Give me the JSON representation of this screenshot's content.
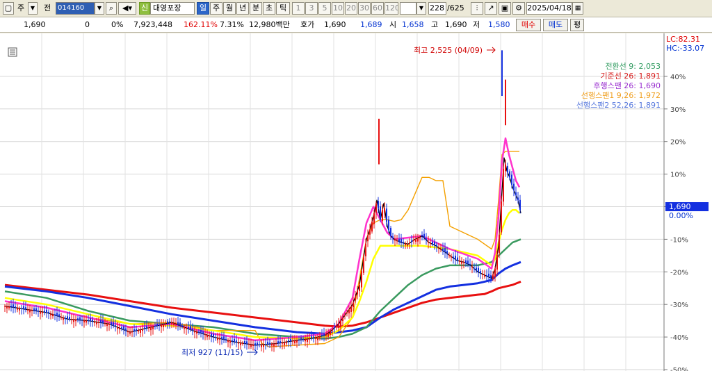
{
  "toolbar": {
    "tab_stock": "주",
    "tab_all": "전",
    "code": "014160",
    "credit_badge": "신",
    "stock_name": "대영포장",
    "periods": [
      "일",
      "주",
      "월",
      "년",
      "분",
      "초",
      "틱"
    ],
    "intervals": [
      "1",
      "3",
      "5",
      "10",
      "20",
      "30",
      "60",
      "120"
    ],
    "count": "228",
    "count_total": "/625",
    "date": "2025/04/18"
  },
  "quote": {
    "price": "1,690",
    "change": "0",
    "change_rate": "0%",
    "volume": "7,923,448",
    "volume_rate": "162.11%",
    "turnover": "7.31%",
    "amount": "12,980백만",
    "ask_label": "호가",
    "ask": "1,690",
    "bid": "1,689",
    "open_label": "시",
    "open": "1,658",
    "high_label": "고",
    "high": "1,690",
    "low_label": "저",
    "low": "1,580",
    "buy_label": "매수",
    "sell_label": "매도",
    "eval_label": "평"
  },
  "chart_data": {
    "type": "line",
    "y_unit": "%",
    "ylim": [
      -50,
      50
    ],
    "yticks": [
      "40%",
      "30%",
      "20%",
      "10%",
      "0.00%",
      "-10%",
      "-20%",
      "-30%",
      "-40%",
      "-50%"
    ],
    "lc_label": "LC:82.31",
    "hc_label": "HC:-33.07",
    "current_price_label": "1,690",
    "current_pct_label": "0.00%",
    "annotation_high": "최고 2,525 (04/09)",
    "annotation_low": "최저 927 (11/15)",
    "grid": true,
    "legend_placement": "top-right",
    "legend": [
      {
        "label": "전환선 9: 2,053",
        "color": "#2e9a5e"
      },
      {
        "label": "기준선 26: 1,891",
        "color": "#d81b1b"
      },
      {
        "label": "후행스팬 26: 1,690",
        "color": "#9a2fd0"
      },
      {
        "label": "선행스팬1 9,26: 1,972",
        "color": "#f0a020"
      },
      {
        "label": "선행스팬2 52,26: 1,891",
        "color": "#5577dd"
      }
    ],
    "colors": {
      "price": "#000000",
      "ma_pink": "#ff33cc",
      "ma_yellow": "#ffff00",
      "ma_orange": "#f4a000",
      "ma_green": "#3a9a5f",
      "ma_blue": "#1430e0",
      "ma_red": "#e81010",
      "up": "#e81010",
      "down": "#1430e0"
    },
    "series": [
      {
        "key": "close",
        "x": [
          0,
          30,
          60,
          90,
          120,
          150,
          180,
          210,
          240,
          270,
          300,
          330,
          360,
          390,
          420,
          440,
          460,
          470,
          480,
          490,
          500,
          510,
          515,
          520,
          525,
          530,
          535,
          540,
          545,
          550,
          555,
          560,
          570,
          580,
          590,
          600,
          610,
          620,
          630,
          640,
          650,
          660,
          670,
          680,
          690,
          700,
          705,
          710,
          715,
          718,
          722,
          726,
          730,
          734,
          738,
          742
        ],
        "y": [
          -30.5,
          -31.5,
          -32.5,
          -34.5,
          -35,
          -36,
          -38.5,
          -37,
          -35.5,
          -38,
          -40,
          -41.5,
          -42.5,
          -42,
          -41,
          -40.5,
          -39.5,
          -38,
          -36,
          -33,
          -30,
          -24,
          -17,
          -10,
          -7,
          -3,
          2,
          -4,
          1,
          -6,
          -9,
          -10,
          -11,
          -11.5,
          -10,
          -9,
          -11,
          -12,
          -13.5,
          -15,
          -16.5,
          -17,
          -18,
          -20,
          -21,
          -22,
          -19,
          -12,
          5,
          15,
          11,
          9,
          6,
          4,
          2,
          -2
        ]
      },
      {
        "key": "ma_pink",
        "x": [
          0,
          60,
          120,
          180,
          240,
          300,
          360,
          420,
          460,
          480,
          500,
          510,
          520,
          530,
          540,
          550,
          560,
          600,
          640,
          680,
          700,
          705,
          710,
          715,
          720,
          725,
          730,
          735,
          740
        ],
        "y": [
          -29,
          -31,
          -34,
          -37,
          -36,
          -39,
          -41,
          -40,
          -39,
          -36,
          -28,
          -16,
          -5,
          0,
          -4,
          -8,
          -10,
          -9,
          -13,
          -16,
          -19,
          -14,
          -3,
          14,
          21,
          16,
          12,
          8,
          6
        ]
      },
      {
        "key": "ma_yellow",
        "x": [
          0,
          60,
          120,
          180,
          240,
          300,
          360,
          420,
          460,
          480,
          500,
          510,
          520,
          530,
          540,
          550,
          560,
          600,
          640,
          680,
          700,
          705,
          710,
          715,
          720,
          725,
          730,
          735,
          740
        ],
        "y": [
          -28,
          -30,
          -33,
          -36,
          -36.5,
          -38,
          -40,
          -40.5,
          -40,
          -38,
          -34,
          -29,
          -23,
          -16,
          -12,
          -12,
          -12,
          -12,
          -13,
          -15,
          -18,
          -16,
          -11,
          -7,
          -4,
          -2,
          -1,
          -1,
          -2
        ]
      },
      {
        "key": "ma_orange",
        "x": [
          0,
          60,
          120,
          180,
          240,
          300,
          360,
          370,
          380,
          420,
          460,
          480,
          500,
          510,
          520,
          530,
          540,
          550,
          560,
          570,
          580,
          590,
          600,
          610,
          620,
          630,
          640,
          660,
          680,
          700,
          705,
          710,
          715,
          720,
          740
        ],
        "y": [
          -29,
          -31,
          -34,
          -36,
          -35.5,
          -38,
          -38,
          -42,
          -43,
          -42.5,
          -42,
          -40,
          -34,
          -22,
          -10,
          -5,
          -4,
          -4,
          -4.5,
          -4,
          -1,
          4,
          9,
          9,
          8,
          8,
          -6,
          -8,
          -10,
          -13,
          -10,
          2,
          16,
          17,
          17
        ]
      },
      {
        "key": "ma_green",
        "x": [
          0,
          60,
          120,
          180,
          240,
          300,
          360,
          420,
          460,
          480,
          500,
          520,
          540,
          560,
          580,
          600,
          620,
          640,
          660,
          680,
          690,
          700,
          710,
          720,
          730,
          742
        ],
        "y": [
          -26,
          -28,
          -32,
          -35,
          -36,
          -37,
          -39,
          -40,
          -40.5,
          -40,
          -39,
          -37,
          -32,
          -28,
          -24,
          -21,
          -19,
          -18,
          -18,
          -18,
          -17.5,
          -17,
          -15,
          -13,
          -11,
          -10
        ]
      },
      {
        "key": "ma_blue",
        "x": [
          0,
          60,
          120,
          180,
          240,
          300,
          360,
          420,
          460,
          480,
          500,
          520,
          540,
          560,
          580,
          600,
          620,
          640,
          660,
          680,
          690,
          700,
          710,
          720,
          730,
          742
        ],
        "y": [
          -24.5,
          -26,
          -28,
          -30.5,
          -33,
          -35,
          -37,
          -38.5,
          -39,
          -38.5,
          -38,
          -37,
          -34,
          -31.5,
          -29.5,
          -27.5,
          -25.5,
          -24.5,
          -24,
          -23.5,
          -23,
          -22.5,
          -20.5,
          -19,
          -18,
          -17
        ]
      },
      {
        "key": "ma_red",
        "x": [
          0,
          60,
          120,
          180,
          240,
          300,
          360,
          420,
          460,
          480,
          500,
          520,
          540,
          560,
          580,
          600,
          620,
          640,
          660,
          680,
          690,
          700,
          710,
          720,
          730,
          742
        ],
        "y": [
          -24,
          -25.5,
          -27,
          -29,
          -31,
          -32.5,
          -34,
          -35.5,
          -36.5,
          -36.8,
          -36.5,
          -35.5,
          -34,
          -32.5,
          -31,
          -29.5,
          -28.5,
          -28,
          -27.5,
          -27,
          -26.8,
          -26,
          -25,
          -24.5,
          -24,
          -23
        ]
      }
    ]
  }
}
